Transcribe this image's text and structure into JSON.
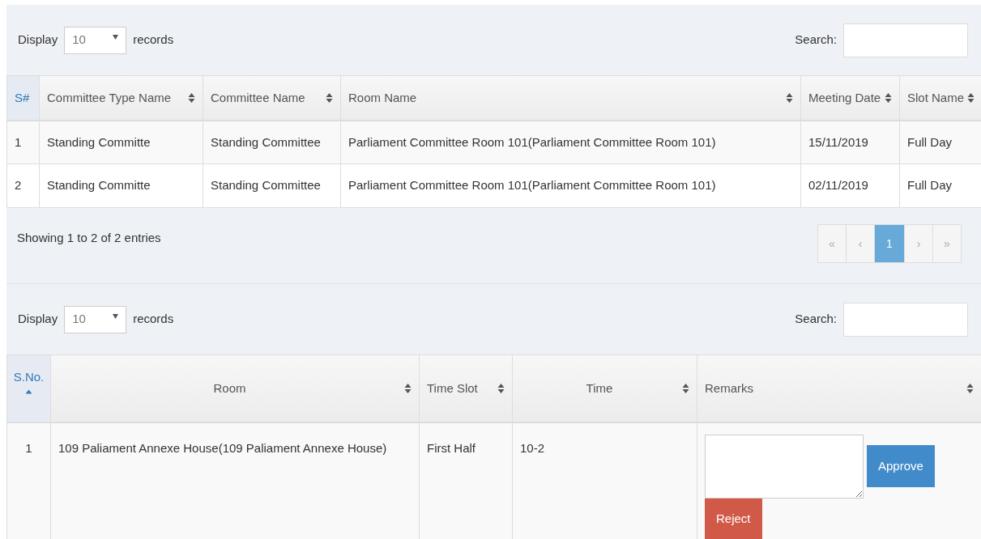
{
  "tables": [
    {
      "length": {
        "prefix": "Display",
        "value": "10",
        "suffix": "records"
      },
      "search": {
        "label": "Search:"
      },
      "columns": [
        {
          "label": "S#",
          "kind": "sorted"
        },
        {
          "label": "Committee Type Name",
          "kind": "sortable"
        },
        {
          "label": "Committee Name",
          "kind": "sortable"
        },
        {
          "label": "Room Name",
          "kind": "sortable"
        },
        {
          "label": "Meeting Date",
          "kind": "sortable"
        },
        {
          "label": "Slot Name",
          "kind": "sortable"
        }
      ],
      "rows": [
        [
          "1",
          "Standing Committe",
          "Standing Committee",
          "Parliament Committee Room 101(Parliament Committee Room 101)",
          "15/11/2019",
          "Full Day"
        ],
        [
          "2",
          "Standing Committe",
          "Standing Committee",
          "Parliament Committee Room 101(Parliament Committee Room 101)",
          "02/11/2019",
          "Full Day"
        ]
      ],
      "info": "Showing 1 to 2 of 2 entries",
      "pagination": [
        {
          "label": "«",
          "selected": false,
          "disabled": true
        },
        {
          "label": "‹",
          "selected": false,
          "disabled": true
        },
        {
          "label": "1",
          "selected": true,
          "disabled": false
        },
        {
          "label": "›",
          "selected": false,
          "disabled": true
        },
        {
          "label": "»",
          "selected": false,
          "disabled": true
        }
      ]
    },
    {
      "length": {
        "prefix": "Display",
        "value": "10",
        "suffix": "records"
      },
      "search": {
        "label": "Search:"
      },
      "columns": [
        {
          "label": "S.No.",
          "kind": "ascending"
        },
        {
          "label": "Room",
          "kind": "sortable"
        },
        {
          "label": "Time Slot",
          "kind": "sortable"
        },
        {
          "label": "Time",
          "kind": "sortable"
        },
        {
          "label": "Remarks",
          "kind": "sortable"
        }
      ],
      "rows": [
        {
          "cells": [
            "1",
            "109 Paliament Annexe House(109 Paliament Annexe House)",
            "First Half",
            "10-2"
          ],
          "actions": [
            {
              "kind": "approve",
              "label": "Approve"
            },
            {
              "kind": "reject",
              "label": "Reject"
            }
          ]
        }
      ]
    }
  ]
}
